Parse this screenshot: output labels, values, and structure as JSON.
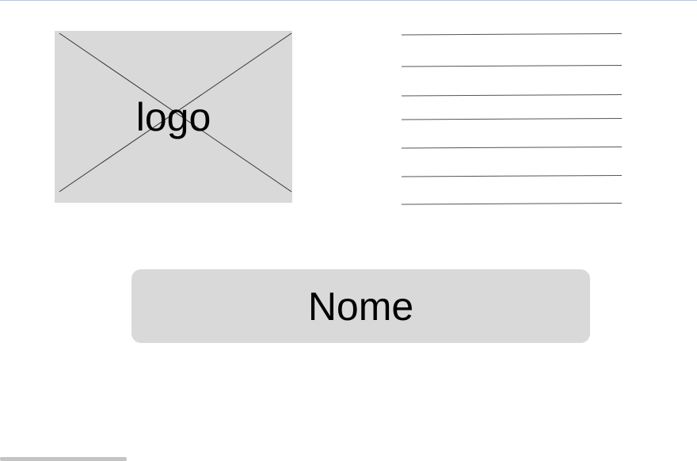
{
  "logo": {
    "label": "logo",
    "icon": "image-placeholder-icon"
  },
  "content_lines": {
    "count": 7
  },
  "name_field": {
    "label": "Nome"
  },
  "colors": {
    "placeholder_fill": "#d9d9d9",
    "line_stroke": "#555555",
    "top_border": "#b7c9d8"
  }
}
